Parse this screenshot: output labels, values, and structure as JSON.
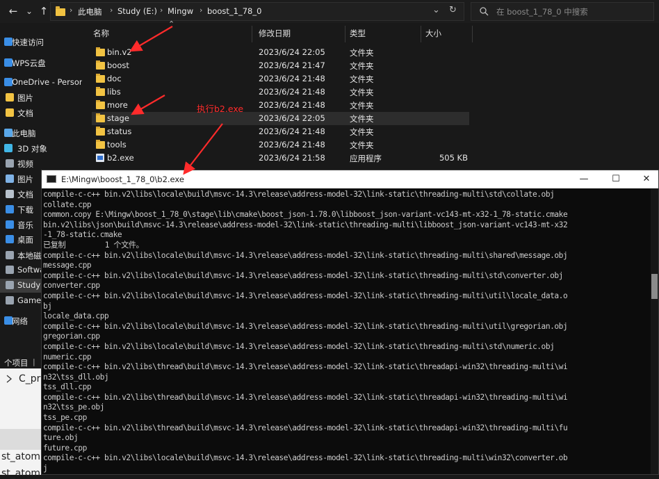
{
  "explorer": {
    "nav": {
      "back": "←",
      "forward": "→",
      "recent": "⌄",
      "up": "↑"
    },
    "breadcrumb": [
      "此电脑",
      "Study (E:)",
      "Mingw",
      "boost_1_78_0"
    ],
    "search_placeholder": "在 boost_1_78_0 中搜索",
    "columns": {
      "name": "名称",
      "date": "修改日期",
      "type": "类型",
      "size": "大小"
    },
    "files": [
      {
        "name": "bin.v2",
        "date": "2023/6/24 22:05",
        "type": "文件夹",
        "size": "",
        "icon": "folder-icon"
      },
      {
        "name": "boost",
        "date": "2023/6/24 21:47",
        "type": "文件夹",
        "size": "",
        "icon": "folder-icon"
      },
      {
        "name": "doc",
        "date": "2023/6/24 21:48",
        "type": "文件夹",
        "size": "",
        "icon": "folder-icon"
      },
      {
        "name": "libs",
        "date": "2023/6/24 21:48",
        "type": "文件夹",
        "size": "",
        "icon": "folder-icon"
      },
      {
        "name": "more",
        "date": "2023/6/24 21:48",
        "type": "文件夹",
        "size": "",
        "icon": "folder-icon"
      },
      {
        "name": "stage",
        "date": "2023/6/24 22:05",
        "type": "文件夹",
        "size": "",
        "icon": "folder-icon"
      },
      {
        "name": "status",
        "date": "2023/6/24 21:48",
        "type": "文件夹",
        "size": "",
        "icon": "folder-icon"
      },
      {
        "name": "tools",
        "date": "2023/6/24 21:48",
        "type": "文件夹",
        "size": "",
        "icon": "folder-icon"
      },
      {
        "name": "b2.exe",
        "date": "2023/6/24 21:58",
        "type": "应用程序",
        "size": "505 KB",
        "icon": "exe-icon"
      }
    ],
    "sidebar": [
      {
        "label": "快速访问",
        "icon": "star-icon",
        "color": "#3a8ee6"
      },
      {
        "label": "WPS云盘",
        "icon": "cloud-icon",
        "color": "#3a8ee6"
      },
      {
        "label": "OneDrive - Person",
        "icon": "onedrive-icon",
        "color": "#3a8ee6"
      },
      {
        "label": "图片",
        "icon": "folder-icon",
        "color": "#f2c343"
      },
      {
        "label": "文档",
        "icon": "folder-icon",
        "color": "#f2c343"
      },
      {
        "label": "此电脑",
        "icon": "computer-icon",
        "color": "#5aa7e8"
      },
      {
        "label": "3D 对象",
        "icon": "cube-icon",
        "color": "#41b6e6"
      },
      {
        "label": "视频",
        "icon": "video-icon",
        "color": "#9aa4b0"
      },
      {
        "label": "图片",
        "icon": "pictures-icon",
        "color": "#7fb2e5"
      },
      {
        "label": "文档",
        "icon": "documents-icon",
        "color": "#b8c2cc"
      },
      {
        "label": "下载",
        "icon": "download-icon",
        "color": "#3a8ee6"
      },
      {
        "label": "音乐",
        "icon": "music-icon",
        "color": "#3a8ee6"
      },
      {
        "label": "桌面",
        "icon": "desktop-icon",
        "color": "#3a8ee6"
      },
      {
        "label": "本地磁",
        "icon": "drive-icon",
        "color": "#9aa4b0"
      },
      {
        "label": "Softwa",
        "icon": "drive-icon",
        "color": "#9aa4b0"
      },
      {
        "label": "Study",
        "icon": "drive-icon",
        "color": "#9aa4b0"
      },
      {
        "label": "Game",
        "icon": "drive-icon",
        "color": "#9aa4b0"
      },
      {
        "label": "网络",
        "icon": "network-icon",
        "color": "#3a8ee6"
      }
    ]
  },
  "annotation": {
    "text": "执行b2.exe",
    "color": "#ff2b2b"
  },
  "console": {
    "title": "E:\\Mingw\\boost_1_78_0\\b2.exe",
    "controls": {
      "minimize": "—",
      "maximize": "☐",
      "close": "✕"
    },
    "lines": [
      "compile-c-c++ bin.v2\\libs\\locale\\build\\msvc-14.3\\release\\address-model-32\\link-static\\threading-multi\\std\\collate.obj",
      "collate.cpp",
      "common.copy E:\\Mingw\\boost_1_78_0\\stage\\lib\\cmake\\boost_json-1.78.0\\libboost_json-variant-vc143-mt-x32-1_78-static.cmake",
      "bin.v2\\libs\\json\\build\\msvc-14.3\\release\\address-model-32\\link-static\\threading-multi\\libboost_json-variant-vc143-mt-x32",
      "-1_78-static.cmake",
      "已复制         1 个文件。",
      "compile-c-c++ bin.v2\\libs\\locale\\build\\msvc-14.3\\release\\address-model-32\\link-static\\threading-multi\\shared\\message.obj",
      "message.cpp",
      "compile-c-c++ bin.v2\\libs\\locale\\build\\msvc-14.3\\release\\address-model-32\\link-static\\threading-multi\\std\\converter.obj",
      "converter.cpp",
      "compile-c-c++ bin.v2\\libs\\locale\\build\\msvc-14.3\\release\\address-model-32\\link-static\\threading-multi\\util\\locale_data.o",
      "bj",
      "locale_data.cpp",
      "compile-c-c++ bin.v2\\libs\\locale\\build\\msvc-14.3\\release\\address-model-32\\link-static\\threading-multi\\util\\gregorian.obj",
      "gregorian.cpp",
      "compile-c-c++ bin.v2\\libs\\locale\\build\\msvc-14.3\\release\\address-model-32\\link-static\\threading-multi\\std\\numeric.obj",
      "numeric.cpp",
      "compile-c-c++ bin.v2\\libs\\thread\\build\\msvc-14.3\\release\\address-model-32\\link-static\\threadapi-win32\\threading-multi\\wi",
      "n32\\tss_dll.obj",
      "tss_dll.cpp",
      "compile-c-c++ bin.v2\\libs\\thread\\build\\msvc-14.3\\release\\address-model-32\\link-static\\threadapi-win32\\threading-multi\\wi",
      "n32\\tss_pe.obj",
      "tss_pe.cpp",
      "compile-c-c++ bin.v2\\libs\\thread\\build\\msvc-14.3\\release\\address-model-32\\link-static\\threadapi-win32\\threading-multi\\fu",
      "ture.obj",
      "future.cpp",
      "compile-c-c++ bin.v2\\libs\\locale\\build\\msvc-14.3\\release\\address-model-32\\link-static\\threading-multi\\win32\\converter.ob",
      "j"
    ]
  },
  "background_app": {
    "status": "个项目",
    "item1": "C_pr",
    "item2": "st_atom",
    "item3": "st_atom"
  }
}
